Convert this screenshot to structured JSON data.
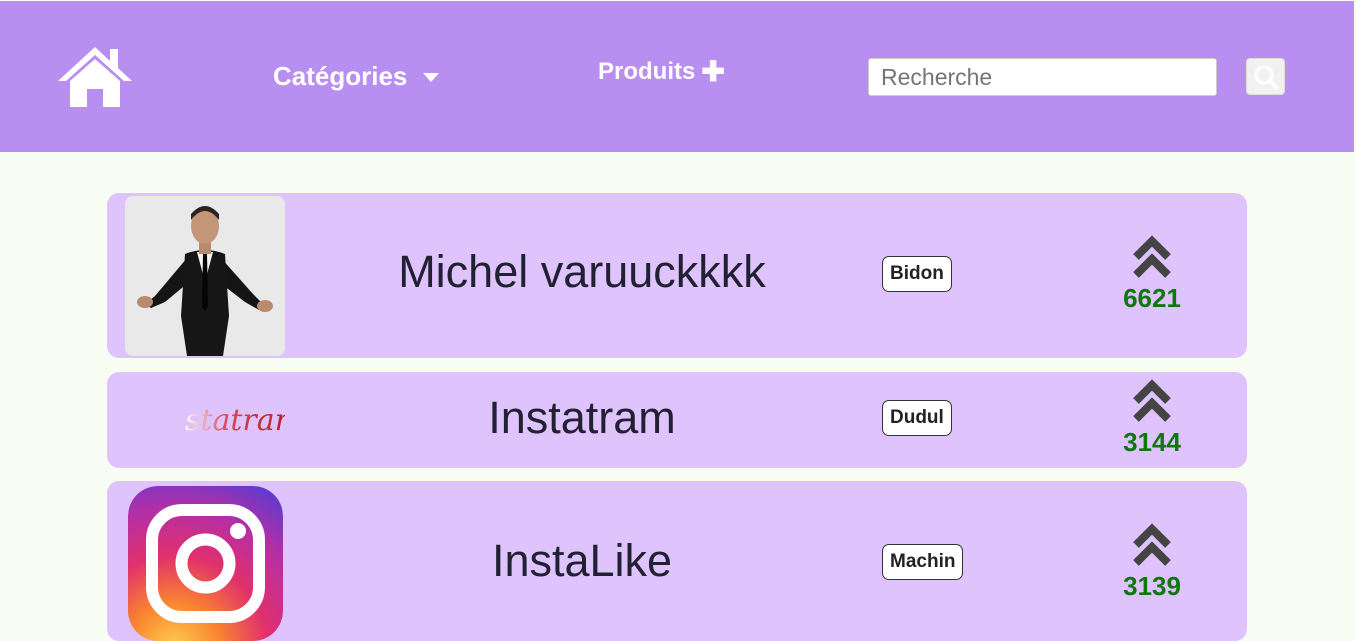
{
  "colors": {
    "navbar": "#b88ef0",
    "page_background": "#f8fdf3",
    "card_background": "#dfc3fd",
    "vote_count": "#117511",
    "vote_arrow": "#444444"
  },
  "navbar": {
    "home_icon": "home-icon",
    "categories_label": "Catégories",
    "products_label": "Produits",
    "search": {
      "placeholder": "Recherche",
      "value": "",
      "button_icon": "search-icon"
    }
  },
  "products": [
    {
      "title": "Michel varuuckkkk",
      "category": "Bidon",
      "votes": "6621",
      "thumbnail": "person-photo",
      "vote_icon": "double-chevron-up-icon"
    },
    {
      "title": "Instatram",
      "category": "Dudul",
      "votes": "3144",
      "thumbnail": "statram-logo",
      "thumbnail_text": "statram",
      "vote_icon": "double-chevron-up-icon"
    },
    {
      "title": "InstaLike",
      "category": "Machin",
      "votes": "3139",
      "thumbnail": "instagram-logo",
      "vote_icon": "double-chevron-up-icon"
    }
  ]
}
